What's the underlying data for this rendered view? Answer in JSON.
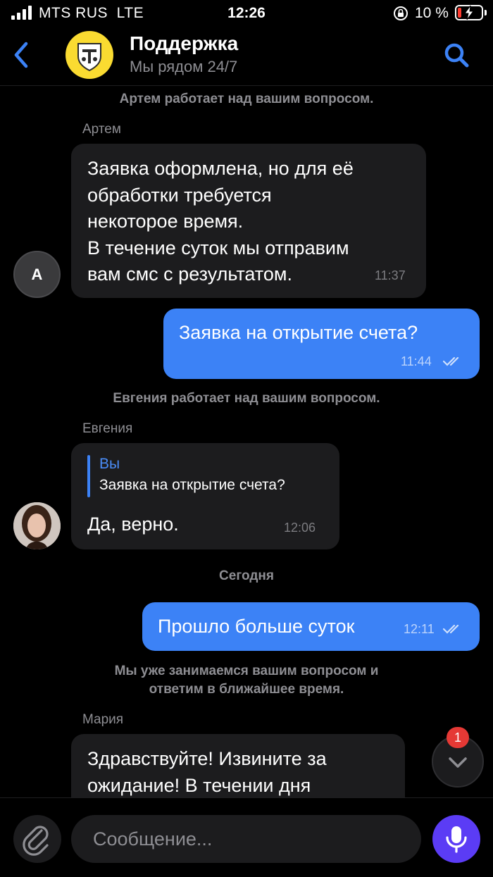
{
  "status_bar": {
    "carrier": "MTS RUS  LTE",
    "time": "12:26",
    "battery": "10 %"
  },
  "header": {
    "title": "Поддержка",
    "subtitle": "Мы рядом 24/7",
    "icons": {
      "back": "chevron-left-icon",
      "avatar": "tinkoff-logo-icon",
      "search": "search-icon"
    }
  },
  "messages": {
    "sys1": "Артем работает над вашим вопросом.",
    "m1": {
      "sender": "Артем",
      "avatar_letter": "A",
      "text": "Заявка оформлена, но для её\nобработки требуется\nнекоторое время.\nВ течение суток мы отправим\nвам смс с результатом.",
      "time": "11:37"
    },
    "m2": {
      "text": "Заявка на открытие счета?",
      "time": "11:44"
    },
    "sys2": "Евгения работает над вашим вопросом.",
    "m3": {
      "sender": "Евгения",
      "reply_author": "Вы",
      "reply_text": "Заявка на открытие счета?",
      "text": "Да, верно.",
      "time": "12:06"
    },
    "date_divider": "Сегодня",
    "m4": {
      "text": "Прошло больше суток",
      "time": "12:11"
    },
    "sys3": "Мы уже занимаемся вашим вопросом и\nответим в ближайшее время.",
    "m5": {
      "sender": "Мария",
      "text": "Здравствуйте! Извините за\nожидание! В течении дня"
    }
  },
  "scroll_down": {
    "unread_count": "1"
  },
  "composer": {
    "placeholder": "Сообщение..."
  },
  "colors": {
    "background": "#000000",
    "bubble_in": "#1c1c1e",
    "bubble_out": "#3c82f6",
    "accent": "#3c82f6",
    "mic": "#5b3cf5",
    "badge": "#e53935",
    "logo": "#fadb31"
  }
}
